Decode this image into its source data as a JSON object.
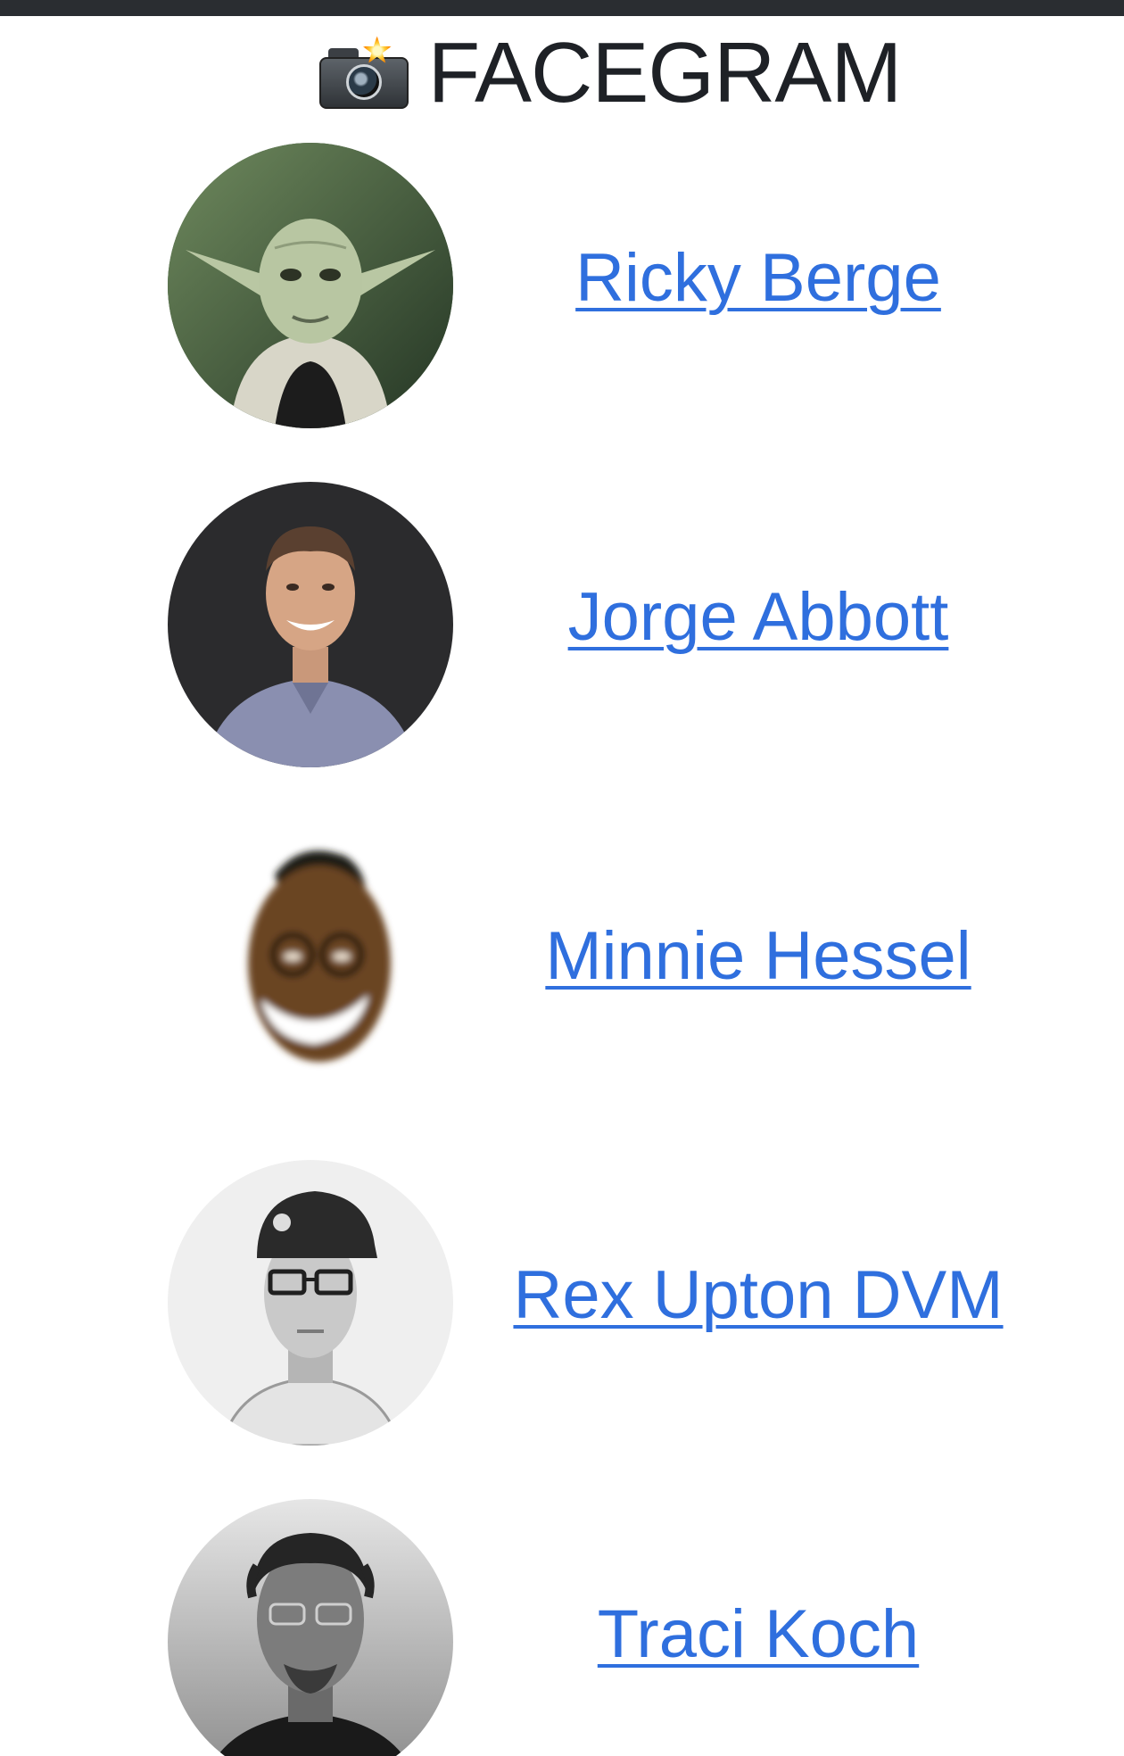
{
  "app": {
    "title": "FACEGRAM",
    "logo_icon": "camera-with-flash-icon"
  },
  "users": [
    {
      "name": "Ricky Berge",
      "avatar": "yoda-avatar"
    },
    {
      "name": "Jorge Abbott",
      "avatar": "smiling-man-avatar"
    },
    {
      "name": "Minnie Hessel",
      "avatar": "cartoon-face-avatar"
    },
    {
      "name": "Rex Upton DVM",
      "avatar": "man-with-cap-avatar"
    },
    {
      "name": "Traci Koch",
      "avatar": "man-with-glasses-avatar"
    }
  ],
  "colors": {
    "link": "#2f6fde",
    "title": "#1e2126",
    "topbar": "#2a2d31"
  }
}
